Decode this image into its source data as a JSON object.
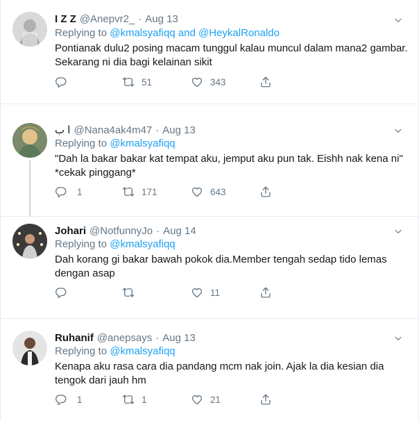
{
  "tweets": [
    {
      "name": "I Z Z",
      "handle": "@Anepvr2_",
      "date": "Aug 13",
      "replying_prefix": "Replying to",
      "mention1": "@kmalsyafiqq",
      "and": "and",
      "mention2": "@HeykalRonaldo",
      "line1": "Pontianak dulu2 posing macam tunggul kalau muncul dalam mana2 gambar.",
      "line2": "Sekarang ni dia bagi kelainan sikit",
      "replies": "",
      "retweets": "51",
      "likes": "343"
    },
    {
      "name": "ا ب",
      "handle": "@Nana4ak4m47",
      "date": "Aug 13",
      "replying_prefix": "Replying to",
      "mention1": "@kmalsyafiqq",
      "line1": "\"Dah la bakar bakar kat tempat aku, jemput aku pun tak. Eishh nak kena ni\"",
      "line2": "*cekak pinggang*",
      "replies": "1",
      "retweets": "171",
      "likes": "643"
    },
    {
      "name": "Johari",
      "handle": "@NotfunnyJo",
      "date": "Aug 14",
      "replying_prefix": "Replying to",
      "mention1": "@kmalsyafiqq",
      "line1": "Dah korang gi bakar bawah pokok dia.Member tengah sedap tido lemas",
      "line2": "dengan asap",
      "replies": "",
      "retweets": "",
      "likes": "11"
    },
    {
      "name": "Ruhanif",
      "handle": "@anepsays",
      "date": "Aug 13",
      "replying_prefix": "Replying to",
      "mention1": "@kmalsyafiqq",
      "line1": "Kenapa aku rasa cara dia pandang mcm nak join. Ajak la dia kesian dia",
      "line2": "tengok dari jauh hm",
      "replies": "1",
      "retweets": "1",
      "likes": "21"
    }
  ],
  "dot": "·",
  "icons": {
    "reply": "reply-icon",
    "retweet": "retweet-icon",
    "like": "heart-icon",
    "share": "share-icon",
    "caret": "chevron-down-icon"
  },
  "colors": {
    "link": "#1da1f2",
    "secondary": "#657786",
    "text": "#14171a",
    "border": "#e6ecf0",
    "thread": "#ccd6dd"
  }
}
